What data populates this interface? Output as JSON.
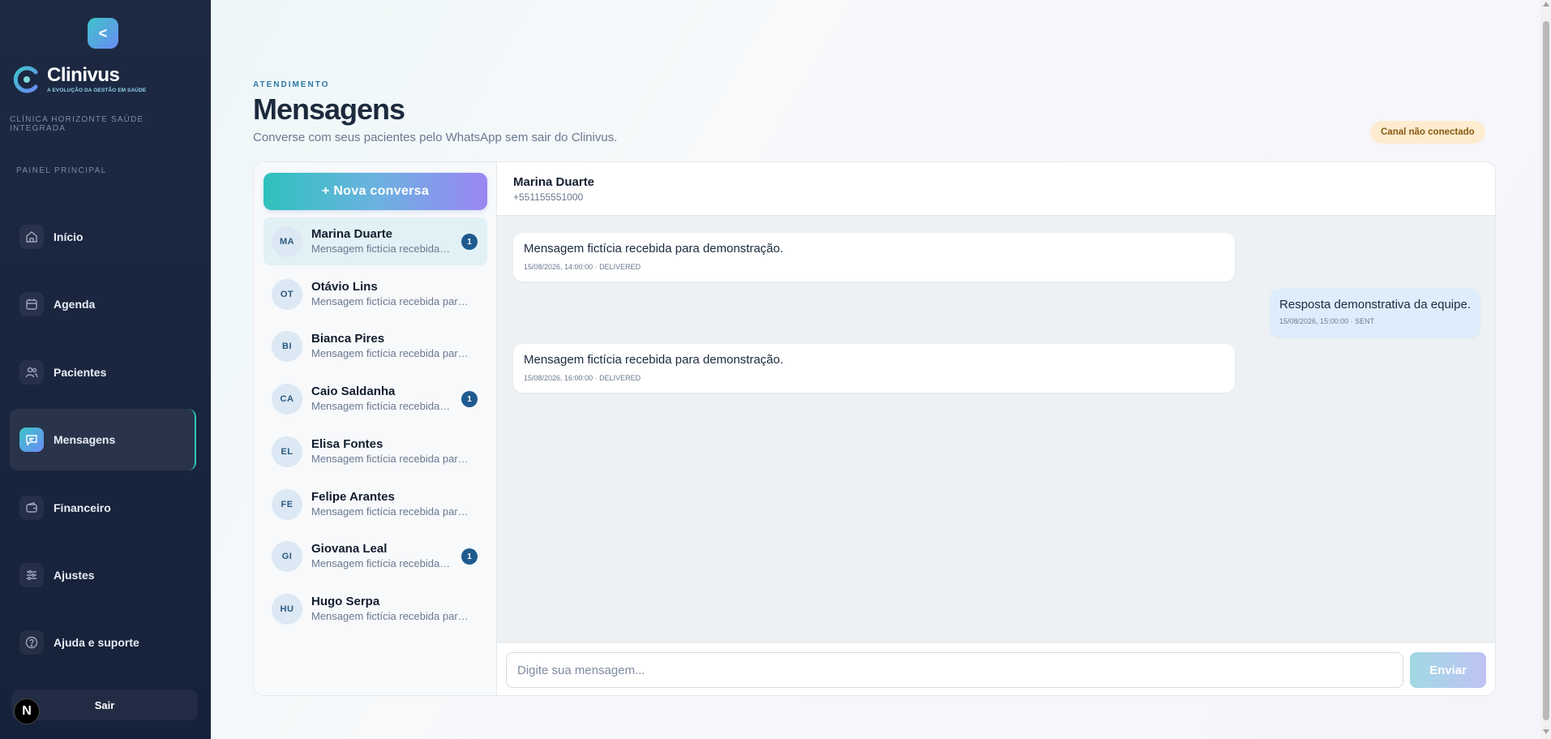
{
  "sidebar": {
    "collapse_icon": "<",
    "brand": {
      "name": "Clinivus",
      "tagline": "A EVOLUÇÃO DA GESTÃO EM SAÚDE"
    },
    "clinic_name": "CLÍNICA HORIZONTE SAÚDE INTEGRADA",
    "section_label": "PAINEL PRINCIPAL",
    "items": [
      {
        "label": "Início",
        "icon": "home-icon"
      },
      {
        "label": "Agenda",
        "icon": "calendar-icon"
      },
      {
        "label": "Pacientes",
        "icon": "users-icon"
      },
      {
        "label": "Mensagens",
        "icon": "message-icon",
        "active": true
      },
      {
        "label": "Financeiro",
        "icon": "wallet-icon"
      },
      {
        "label": "Ajustes",
        "icon": "sliders-icon"
      },
      {
        "label": "Ajuda e suporte",
        "icon": "help-icon"
      }
    ],
    "logout_label": "Sair",
    "dev_badge": "N"
  },
  "header": {
    "eyebrow": "ATENDIMENTO",
    "title": "Mensagens",
    "subtitle": "Converse com seus pacientes pelo WhatsApp sem sair do Clinivus.",
    "status_badge": "Canal não conectado"
  },
  "conversations": {
    "new_button": "+ Nova conversa",
    "items": [
      {
        "initials": "MA",
        "name": "Marina Duarte",
        "preview": "Mensagem fictícia recebida para demonstração.",
        "unread": "1",
        "active": true
      },
      {
        "initials": "OT",
        "name": "Otávio Lins",
        "preview": "Mensagem fictícia recebida para demonstração.",
        "unread": ""
      },
      {
        "initials": "BI",
        "name": "Bianca Pires",
        "preview": "Mensagem fictícia recebida para demonstração.",
        "unread": ""
      },
      {
        "initials": "CA",
        "name": "Caio Saldanha",
        "preview": "Mensagem fictícia recebida para demonstração.",
        "unread": "1"
      },
      {
        "initials": "EL",
        "name": "Elisa Fontes",
        "preview": "Mensagem fictícia recebida para demonstração.",
        "unread": ""
      },
      {
        "initials": "FE",
        "name": "Felipe Arantes",
        "preview": "Mensagem fictícia recebida para demonstração.",
        "unread": ""
      },
      {
        "initials": "GI",
        "name": "Giovana Leal",
        "preview": "Mensagem fictícia recebida para demonstração.",
        "unread": "1"
      },
      {
        "initials": "HU",
        "name": "Hugo Serpa",
        "preview": "Mensagem fictícia recebida para demonstração.",
        "unread": ""
      }
    ]
  },
  "chat": {
    "contact_name": "Marina Duarte",
    "contact_phone": "+551155551000",
    "messages": [
      {
        "direction": "in",
        "text": "Mensagem fictícia recebida para demonstração.",
        "meta": "15/08/2026, 14:00:00 · DELIVERED"
      },
      {
        "direction": "out",
        "text": "Resposta demonstrativa da equipe.",
        "meta": "15/08/2026, 15:00:00 · SENT"
      },
      {
        "direction": "in",
        "text": "Mensagem fictícia recebida para demonstração.",
        "meta": "15/08/2026, 16:00:00 · DELIVERED"
      }
    ],
    "input_placeholder": "Digite sua mensagem...",
    "send_label": "Enviar"
  },
  "colors": {
    "sidebar_bg": "#1d2942",
    "accent_teal": "#2fc1bd",
    "accent_purple": "#9a86f3",
    "badge_bg": "#fdeccf",
    "unread_badge": "#1f5a8f"
  }
}
